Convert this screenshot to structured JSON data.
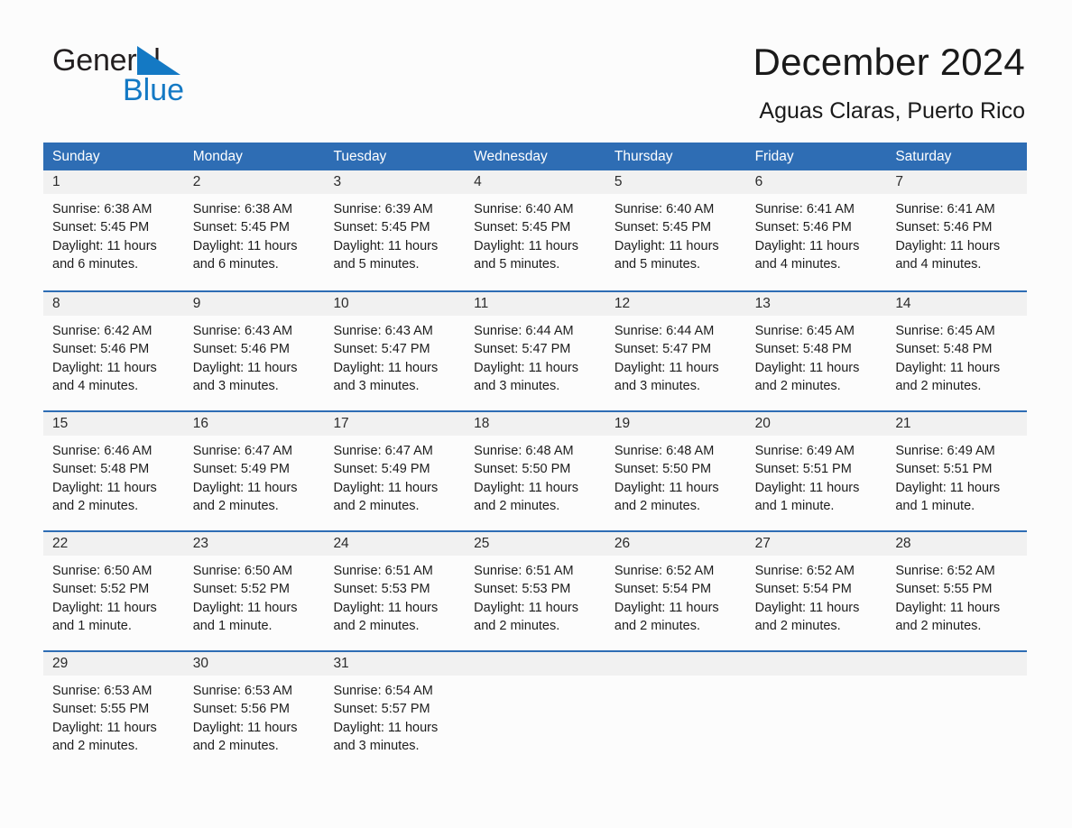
{
  "brand": {
    "word_general": "General",
    "word_blue": "Blue",
    "triangle_color": "#1479C4",
    "text_color": "#231F20"
  },
  "header": {
    "title": "December 2024",
    "subtitle": "Aguas Claras, Puerto Rico"
  },
  "theme": {
    "header_blue": "#2E6DB4",
    "daynum_band": "#F1F1F1",
    "page_background": "#FCFCFC",
    "body_text": "#1D1D1D"
  },
  "calendar": {
    "weekday_headers": [
      "Sunday",
      "Monday",
      "Tuesday",
      "Wednesday",
      "Thursday",
      "Friday",
      "Saturday"
    ],
    "weeks": [
      [
        {
          "day": "1",
          "sunrise": "Sunrise: 6:38 AM",
          "sunset": "Sunset: 5:45 PM",
          "daylight_line1": "Daylight: 11 hours",
          "daylight_line2": "and 6 minutes."
        },
        {
          "day": "2",
          "sunrise": "Sunrise: 6:38 AM",
          "sunset": "Sunset: 5:45 PM",
          "daylight_line1": "Daylight: 11 hours",
          "daylight_line2": "and 6 minutes."
        },
        {
          "day": "3",
          "sunrise": "Sunrise: 6:39 AM",
          "sunset": "Sunset: 5:45 PM",
          "daylight_line1": "Daylight: 11 hours",
          "daylight_line2": "and 5 minutes."
        },
        {
          "day": "4",
          "sunrise": "Sunrise: 6:40 AM",
          "sunset": "Sunset: 5:45 PM",
          "daylight_line1": "Daylight: 11 hours",
          "daylight_line2": "and 5 minutes."
        },
        {
          "day": "5",
          "sunrise": "Sunrise: 6:40 AM",
          "sunset": "Sunset: 5:45 PM",
          "daylight_line1": "Daylight: 11 hours",
          "daylight_line2": "and 5 minutes."
        },
        {
          "day": "6",
          "sunrise": "Sunrise: 6:41 AM",
          "sunset": "Sunset: 5:46 PM",
          "daylight_line1": "Daylight: 11 hours",
          "daylight_line2": "and 4 minutes."
        },
        {
          "day": "7",
          "sunrise": "Sunrise: 6:41 AM",
          "sunset": "Sunset: 5:46 PM",
          "daylight_line1": "Daylight: 11 hours",
          "daylight_line2": "and 4 minutes."
        }
      ],
      [
        {
          "day": "8",
          "sunrise": "Sunrise: 6:42 AM",
          "sunset": "Sunset: 5:46 PM",
          "daylight_line1": "Daylight: 11 hours",
          "daylight_line2": "and 4 minutes."
        },
        {
          "day": "9",
          "sunrise": "Sunrise: 6:43 AM",
          "sunset": "Sunset: 5:46 PM",
          "daylight_line1": "Daylight: 11 hours",
          "daylight_line2": "and 3 minutes."
        },
        {
          "day": "10",
          "sunrise": "Sunrise: 6:43 AM",
          "sunset": "Sunset: 5:47 PM",
          "daylight_line1": "Daylight: 11 hours",
          "daylight_line2": "and 3 minutes."
        },
        {
          "day": "11",
          "sunrise": "Sunrise: 6:44 AM",
          "sunset": "Sunset: 5:47 PM",
          "daylight_line1": "Daylight: 11 hours",
          "daylight_line2": "and 3 minutes."
        },
        {
          "day": "12",
          "sunrise": "Sunrise: 6:44 AM",
          "sunset": "Sunset: 5:47 PM",
          "daylight_line1": "Daylight: 11 hours",
          "daylight_line2": "and 3 minutes."
        },
        {
          "day": "13",
          "sunrise": "Sunrise: 6:45 AM",
          "sunset": "Sunset: 5:48 PM",
          "daylight_line1": "Daylight: 11 hours",
          "daylight_line2": "and 2 minutes."
        },
        {
          "day": "14",
          "sunrise": "Sunrise: 6:45 AM",
          "sunset": "Sunset: 5:48 PM",
          "daylight_line1": "Daylight: 11 hours",
          "daylight_line2": "and 2 minutes."
        }
      ],
      [
        {
          "day": "15",
          "sunrise": "Sunrise: 6:46 AM",
          "sunset": "Sunset: 5:48 PM",
          "daylight_line1": "Daylight: 11 hours",
          "daylight_line2": "and 2 minutes."
        },
        {
          "day": "16",
          "sunrise": "Sunrise: 6:47 AM",
          "sunset": "Sunset: 5:49 PM",
          "daylight_line1": "Daylight: 11 hours",
          "daylight_line2": "and 2 minutes."
        },
        {
          "day": "17",
          "sunrise": "Sunrise: 6:47 AM",
          "sunset": "Sunset: 5:49 PM",
          "daylight_line1": "Daylight: 11 hours",
          "daylight_line2": "and 2 minutes."
        },
        {
          "day": "18",
          "sunrise": "Sunrise: 6:48 AM",
          "sunset": "Sunset: 5:50 PM",
          "daylight_line1": "Daylight: 11 hours",
          "daylight_line2": "and 2 minutes."
        },
        {
          "day": "19",
          "sunrise": "Sunrise: 6:48 AM",
          "sunset": "Sunset: 5:50 PM",
          "daylight_line1": "Daylight: 11 hours",
          "daylight_line2": "and 2 minutes."
        },
        {
          "day": "20",
          "sunrise": "Sunrise: 6:49 AM",
          "sunset": "Sunset: 5:51 PM",
          "daylight_line1": "Daylight: 11 hours",
          "daylight_line2": "and 1 minute."
        },
        {
          "day": "21",
          "sunrise": "Sunrise: 6:49 AM",
          "sunset": "Sunset: 5:51 PM",
          "daylight_line1": "Daylight: 11 hours",
          "daylight_line2": "and 1 minute."
        }
      ],
      [
        {
          "day": "22",
          "sunrise": "Sunrise: 6:50 AM",
          "sunset": "Sunset: 5:52 PM",
          "daylight_line1": "Daylight: 11 hours",
          "daylight_line2": "and 1 minute."
        },
        {
          "day": "23",
          "sunrise": "Sunrise: 6:50 AM",
          "sunset": "Sunset: 5:52 PM",
          "daylight_line1": "Daylight: 11 hours",
          "daylight_line2": "and 1 minute."
        },
        {
          "day": "24",
          "sunrise": "Sunrise: 6:51 AM",
          "sunset": "Sunset: 5:53 PM",
          "daylight_line1": "Daylight: 11 hours",
          "daylight_line2": "and 2 minutes."
        },
        {
          "day": "25",
          "sunrise": "Sunrise: 6:51 AM",
          "sunset": "Sunset: 5:53 PM",
          "daylight_line1": "Daylight: 11 hours",
          "daylight_line2": "and 2 minutes."
        },
        {
          "day": "26",
          "sunrise": "Sunrise: 6:52 AM",
          "sunset": "Sunset: 5:54 PM",
          "daylight_line1": "Daylight: 11 hours",
          "daylight_line2": "and 2 minutes."
        },
        {
          "day": "27",
          "sunrise": "Sunrise: 6:52 AM",
          "sunset": "Sunset: 5:54 PM",
          "daylight_line1": "Daylight: 11 hours",
          "daylight_line2": "and 2 minutes."
        },
        {
          "day": "28",
          "sunrise": "Sunrise: 6:52 AM",
          "sunset": "Sunset: 5:55 PM",
          "daylight_line1": "Daylight: 11 hours",
          "daylight_line2": "and 2 minutes."
        }
      ],
      [
        {
          "day": "29",
          "sunrise": "Sunrise: 6:53 AM",
          "sunset": "Sunset: 5:55 PM",
          "daylight_line1": "Daylight: 11 hours",
          "daylight_line2": "and 2 minutes."
        },
        {
          "day": "30",
          "sunrise": "Sunrise: 6:53 AM",
          "sunset": "Sunset: 5:56 PM",
          "daylight_line1": "Daylight: 11 hours",
          "daylight_line2": "and 2 minutes."
        },
        {
          "day": "31",
          "sunrise": "Sunrise: 6:54 AM",
          "sunset": "Sunset: 5:57 PM",
          "daylight_line1": "Daylight: 11 hours",
          "daylight_line2": "and 3 minutes."
        },
        {
          "day": "",
          "sunrise": "",
          "sunset": "",
          "daylight_line1": "",
          "daylight_line2": ""
        },
        {
          "day": "",
          "sunrise": "",
          "sunset": "",
          "daylight_line1": "",
          "daylight_line2": ""
        },
        {
          "day": "",
          "sunrise": "",
          "sunset": "",
          "daylight_line1": "",
          "daylight_line2": ""
        },
        {
          "day": "",
          "sunrise": "",
          "sunset": "",
          "daylight_line1": "",
          "daylight_line2": ""
        }
      ]
    ]
  }
}
